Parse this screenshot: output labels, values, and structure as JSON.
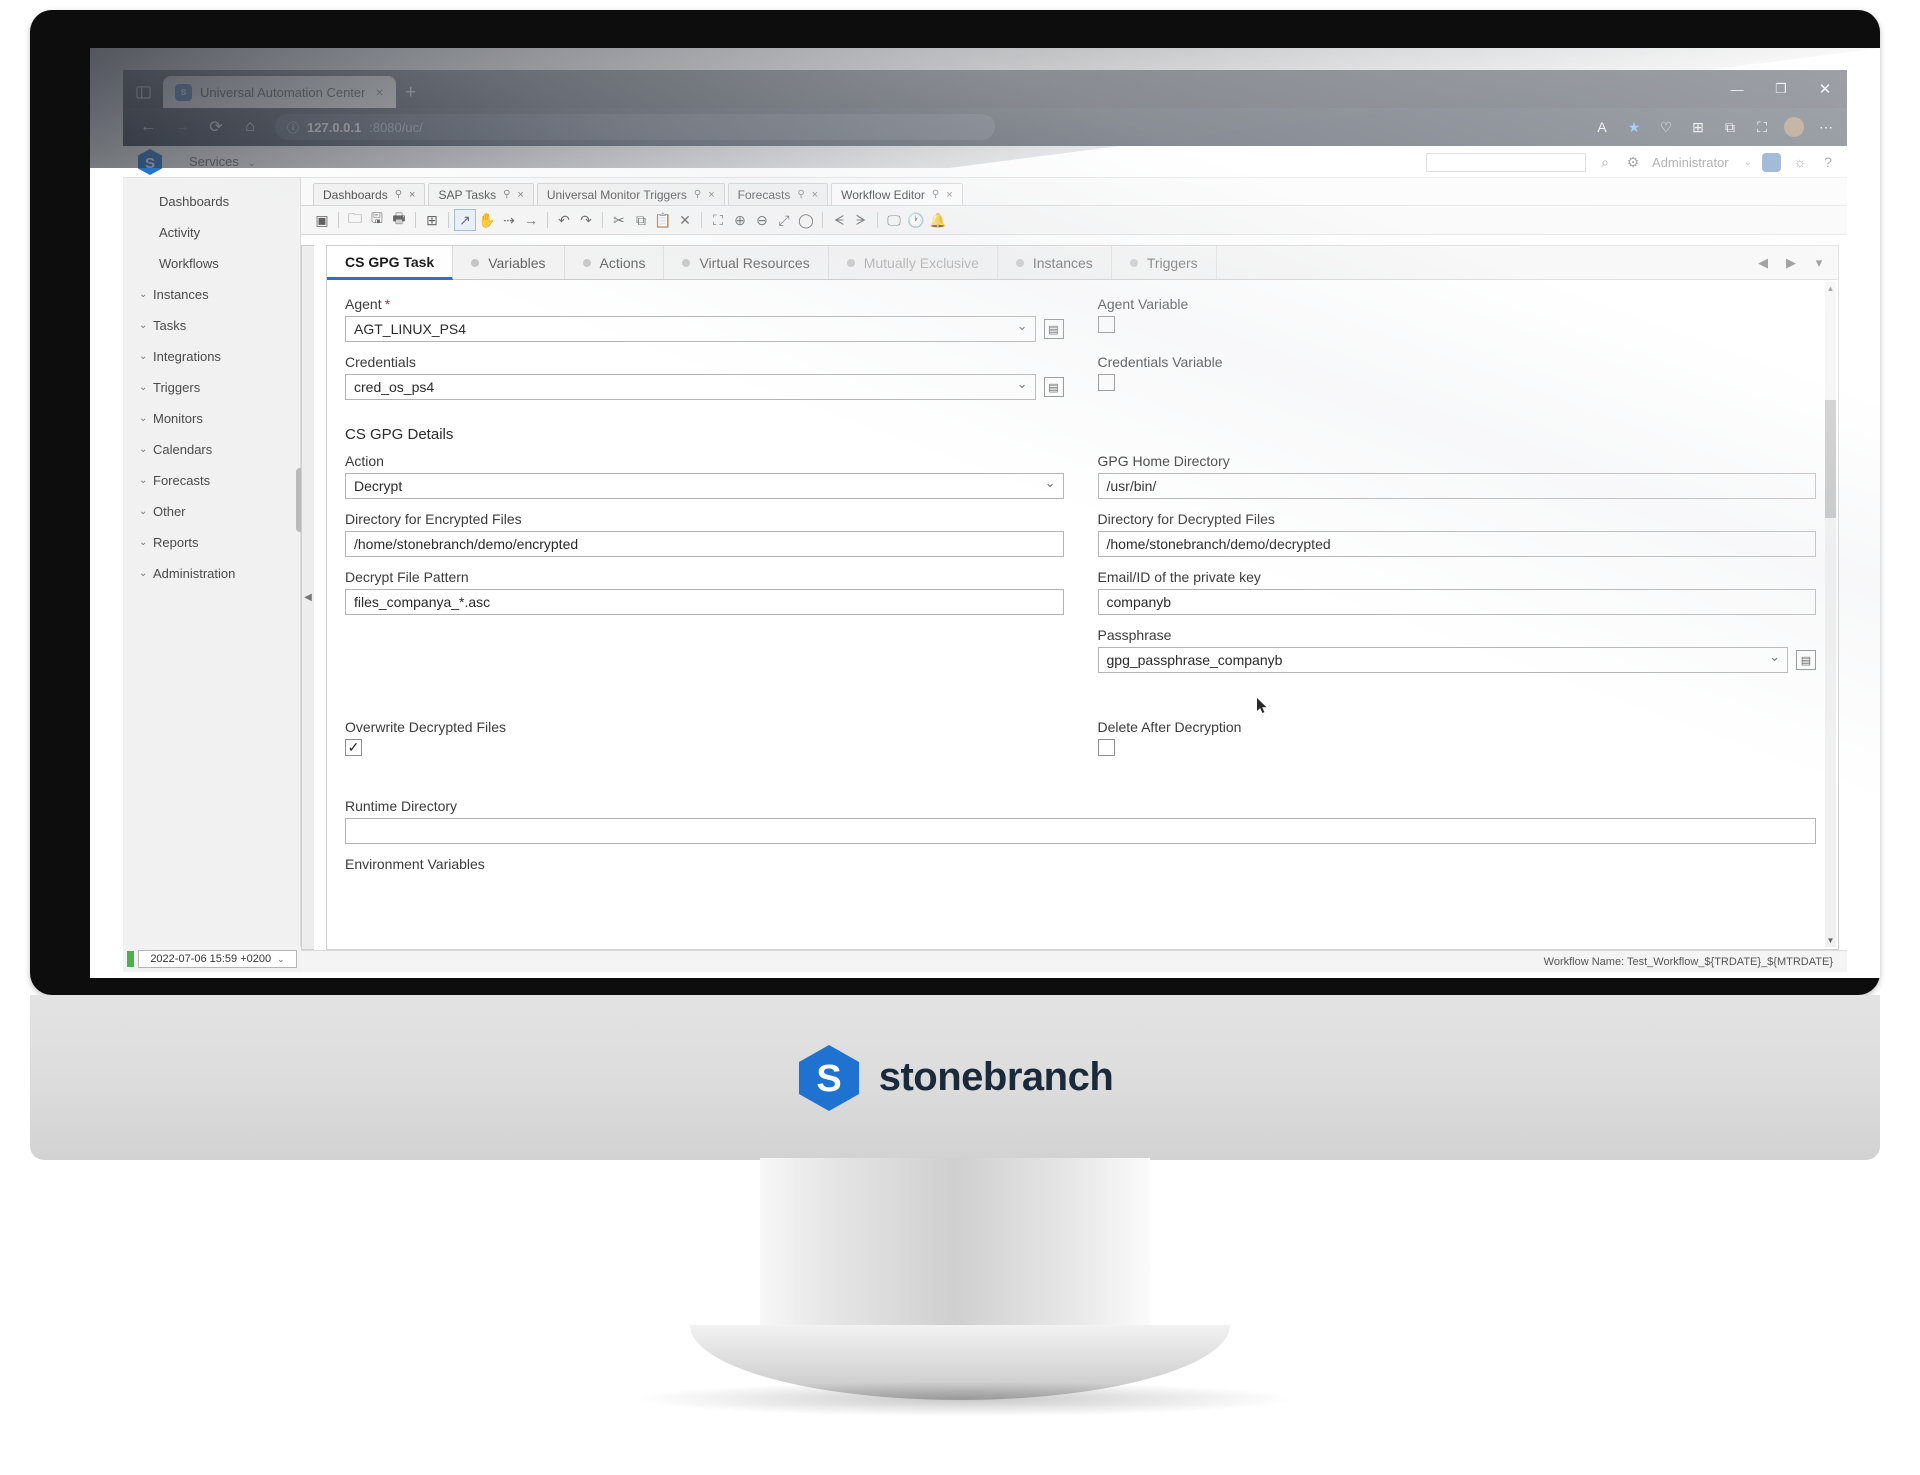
{
  "browser": {
    "tab": {
      "title": "Universal Automation Center",
      "favicon": "s",
      "close_icon": "×"
    },
    "new_tab_icon": "+",
    "tab_sidebar_icon": "tab-sidebar-icon",
    "window_controls": {
      "minimize": "—",
      "maximize": "❐",
      "close": "✕"
    },
    "nav": {
      "back": "←",
      "forward": "→",
      "reload": "⟳",
      "home": "⌂"
    },
    "address": {
      "info_icon": "ⓘ",
      "host": "127.0.0.1",
      "path": ":8080/uc/"
    },
    "toolbar_right": [
      "A",
      "★",
      "♡",
      "⊞",
      "⧉",
      "⛶",
      "⋯"
    ]
  },
  "uac": {
    "logo": "S",
    "services_label": "Services",
    "chevron": "⌄",
    "search_placeholder": "",
    "search_value": "",
    "header_icons": {
      "search": "⌕",
      "gear": "⚙",
      "home": "⌂",
      "bell": "🔔",
      "help": "?"
    },
    "user": "Administrator",
    "sidebar": {
      "items": [
        {
          "label": "Dashboards",
          "expandable": false
        },
        {
          "label": "Activity",
          "expandable": false
        },
        {
          "label": "Workflows",
          "expandable": false
        },
        {
          "label": "Instances",
          "expandable": true
        },
        {
          "label": "Tasks",
          "expandable": true
        },
        {
          "label": "Integrations",
          "expandable": true
        },
        {
          "label": "Triggers",
          "expandable": true
        },
        {
          "label": "Monitors",
          "expandable": true
        },
        {
          "label": "Calendars",
          "expandable": true
        },
        {
          "label": "Forecasts",
          "expandable": true
        },
        {
          "label": "Other",
          "expandable": true
        },
        {
          "label": "Reports",
          "expandable": true
        },
        {
          "label": "Administration",
          "expandable": true
        }
      ],
      "caret": "⌄",
      "date_value": "2022-07-06 15:59 +0200",
      "date_chevron": "⌄"
    },
    "tabs": [
      {
        "label": "Dashboards",
        "active": false
      },
      {
        "label": "SAP Tasks",
        "active": false
      },
      {
        "label": "Universal Monitor Triggers",
        "active": false
      },
      {
        "label": "Forecasts",
        "active": false
      },
      {
        "label": "Workflow Editor",
        "active": true
      }
    ],
    "tab_pin_icon": "⚲",
    "tab_close_icon": "×",
    "toolbar": [
      {
        "name": "find-icon",
        "glyph": "▣",
        "selected": false
      },
      {
        "sep": true
      },
      {
        "name": "open-folder-icon",
        "glyph": "🗀",
        "selected": false
      },
      {
        "name": "save-icon",
        "glyph": "🖫",
        "selected": false
      },
      {
        "name": "print-icon",
        "glyph": "🖶",
        "selected": false
      },
      {
        "sep": true
      },
      {
        "name": "add-task-icon",
        "glyph": "⊞",
        "selected": false
      },
      {
        "sep": true
      },
      {
        "name": "select-pointer-icon",
        "glyph": "↗",
        "selected": true
      },
      {
        "name": "pan-hand-icon",
        "glyph": "✋",
        "selected": false
      },
      {
        "name": "connector-icon",
        "glyph": "⇢",
        "selected": false
      },
      {
        "name": "arrow-icon",
        "glyph": "→",
        "selected": false
      },
      {
        "sep": true
      },
      {
        "name": "undo-icon",
        "glyph": "↶",
        "selected": false
      },
      {
        "name": "redo-icon",
        "glyph": "↷",
        "selected": false
      },
      {
        "sep": true
      },
      {
        "name": "cut-icon",
        "glyph": "✂",
        "selected": false
      },
      {
        "name": "copy-icon",
        "glyph": "⧉",
        "selected": false
      },
      {
        "name": "paste-icon",
        "glyph": "📋",
        "selected": false
      },
      {
        "name": "delete-icon",
        "glyph": "✕",
        "selected": false
      },
      {
        "sep": true
      },
      {
        "name": "fit-to-window-icon",
        "glyph": "⛶",
        "selected": false
      },
      {
        "name": "zoom-in-icon",
        "glyph": "⊕",
        "selected": false
      },
      {
        "name": "zoom-out-icon",
        "glyph": "⊖",
        "selected": false
      },
      {
        "name": "expand-icon",
        "glyph": "⤢",
        "selected": false
      },
      {
        "name": "reset-zoom-icon",
        "glyph": "◯",
        "selected": false
      },
      {
        "sep": true
      },
      {
        "name": "layout-horizontal-icon",
        "glyph": "ᗕ",
        "selected": false
      },
      {
        "name": "layout-vertical-icon",
        "glyph": "ᗒ",
        "selected": false
      },
      {
        "sep": true
      },
      {
        "name": "monitor-icon",
        "glyph": "🖵",
        "selected": false
      },
      {
        "name": "clock-icon",
        "glyph": "🕐",
        "selected": false
      },
      {
        "name": "alert-bell-icon",
        "glyph": "🔔",
        "selected": false
      }
    ],
    "form_tabs": [
      {
        "label": "CS GPG Task",
        "active": true,
        "dot": false,
        "muted": false
      },
      {
        "label": "Variables",
        "active": false,
        "dot": true,
        "muted": false
      },
      {
        "label": "Actions",
        "active": false,
        "dot": true,
        "muted": false
      },
      {
        "label": "Virtual Resources",
        "active": false,
        "dot": true,
        "muted": false
      },
      {
        "label": "Mutually Exclusive",
        "active": false,
        "dot": true,
        "muted": true
      },
      {
        "label": "Instances",
        "active": false,
        "dot": true,
        "muted": false
      },
      {
        "label": "Triggers",
        "active": false,
        "dot": true,
        "muted": false
      }
    ],
    "form_tab_nav": {
      "prev": "◀",
      "next": "▶",
      "more": "▾"
    },
    "form": {
      "agent": {
        "label": "Agent",
        "required_marker": "*",
        "value": "AGT_LINUX_PS4"
      },
      "agent_variable": {
        "label": "Agent Variable",
        "checked": false
      },
      "credentials": {
        "label": "Credentials",
        "value": "cred_os_ps4"
      },
      "credentials_variable": {
        "label": "Credentials Variable",
        "checked": false
      },
      "details_title": "CS GPG Details",
      "action": {
        "label": "Action",
        "value": "Decrypt"
      },
      "gpg_home_directory": {
        "label": "GPG Home Directory",
        "value": "/usr/bin/"
      },
      "dir_encrypted": {
        "label": "Directory for Encrypted Files",
        "value": "/home/stonebranch/demo/encrypted"
      },
      "dir_decrypted": {
        "label": "Directory for Decrypted Files",
        "value": "/home/stonebranch/demo/decrypted"
      },
      "decrypt_file_pattern": {
        "label": "Decrypt File Pattern",
        "value": "files_companya_*.asc"
      },
      "email_private_key": {
        "label": "Email/ID of the private key",
        "value": "companyb"
      },
      "passphrase": {
        "label": "Passphrase",
        "value": "gpg_passphrase_companyb"
      },
      "overwrite_decrypted": {
        "label": "Overwrite Decrypted Files",
        "checked": true,
        "check_glyph": "✓"
      },
      "delete_after_decryption": {
        "label": "Delete After Decryption",
        "checked": false
      },
      "runtime_directory": {
        "label": "Runtime Directory",
        "value": ""
      },
      "environment_variables": {
        "label": "Environment Variables"
      },
      "picker_icon": "▤"
    },
    "status_bar": "Workflow Name: Test_Workflow_${TRDATE}_${MTRDATE}"
  },
  "monitor": {
    "brand_name": "stonebranch",
    "brand_mark": "S"
  },
  "colors": {
    "accent": "#2f6fc5",
    "brand_blue": "#1f72d0",
    "required_red": "#cc2c2c",
    "browser_chrome": "#2b3340",
    "sidebar_bg": "#f1f1f1"
  }
}
